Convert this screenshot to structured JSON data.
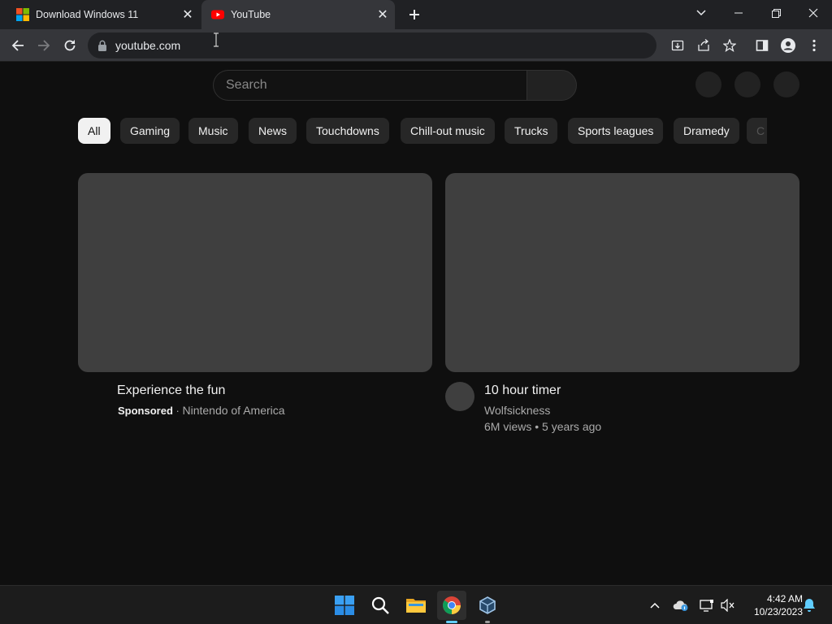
{
  "browser": {
    "tabs": [
      {
        "title": "Download Windows 11",
        "favicon": "windows-logo-icon",
        "active": false
      },
      {
        "title": "YouTube",
        "favicon": "youtube-logo-icon",
        "active": true
      }
    ],
    "address": "youtube.com"
  },
  "youtube": {
    "search_placeholder": "Search",
    "chips": [
      {
        "label": "All",
        "active": true
      },
      {
        "label": "Gaming"
      },
      {
        "label": "Music"
      },
      {
        "label": "News"
      },
      {
        "label": "Touchdowns"
      },
      {
        "label": "Chill-out music"
      },
      {
        "label": "Trucks"
      },
      {
        "label": "Sports leagues"
      },
      {
        "label": "Dramedy"
      },
      {
        "label": "C"
      }
    ],
    "videos": [
      {
        "title": "Experience the fun",
        "sponsored": "Sponsored",
        "separator": " · ",
        "channel": "Nintendo of America"
      },
      {
        "title": "10 hour timer",
        "channel": "Wolfsickness",
        "stats": "6M views • 5 years ago"
      }
    ]
  },
  "taskbar": {
    "time": "4:42 AM",
    "date": "10/23/2023"
  }
}
